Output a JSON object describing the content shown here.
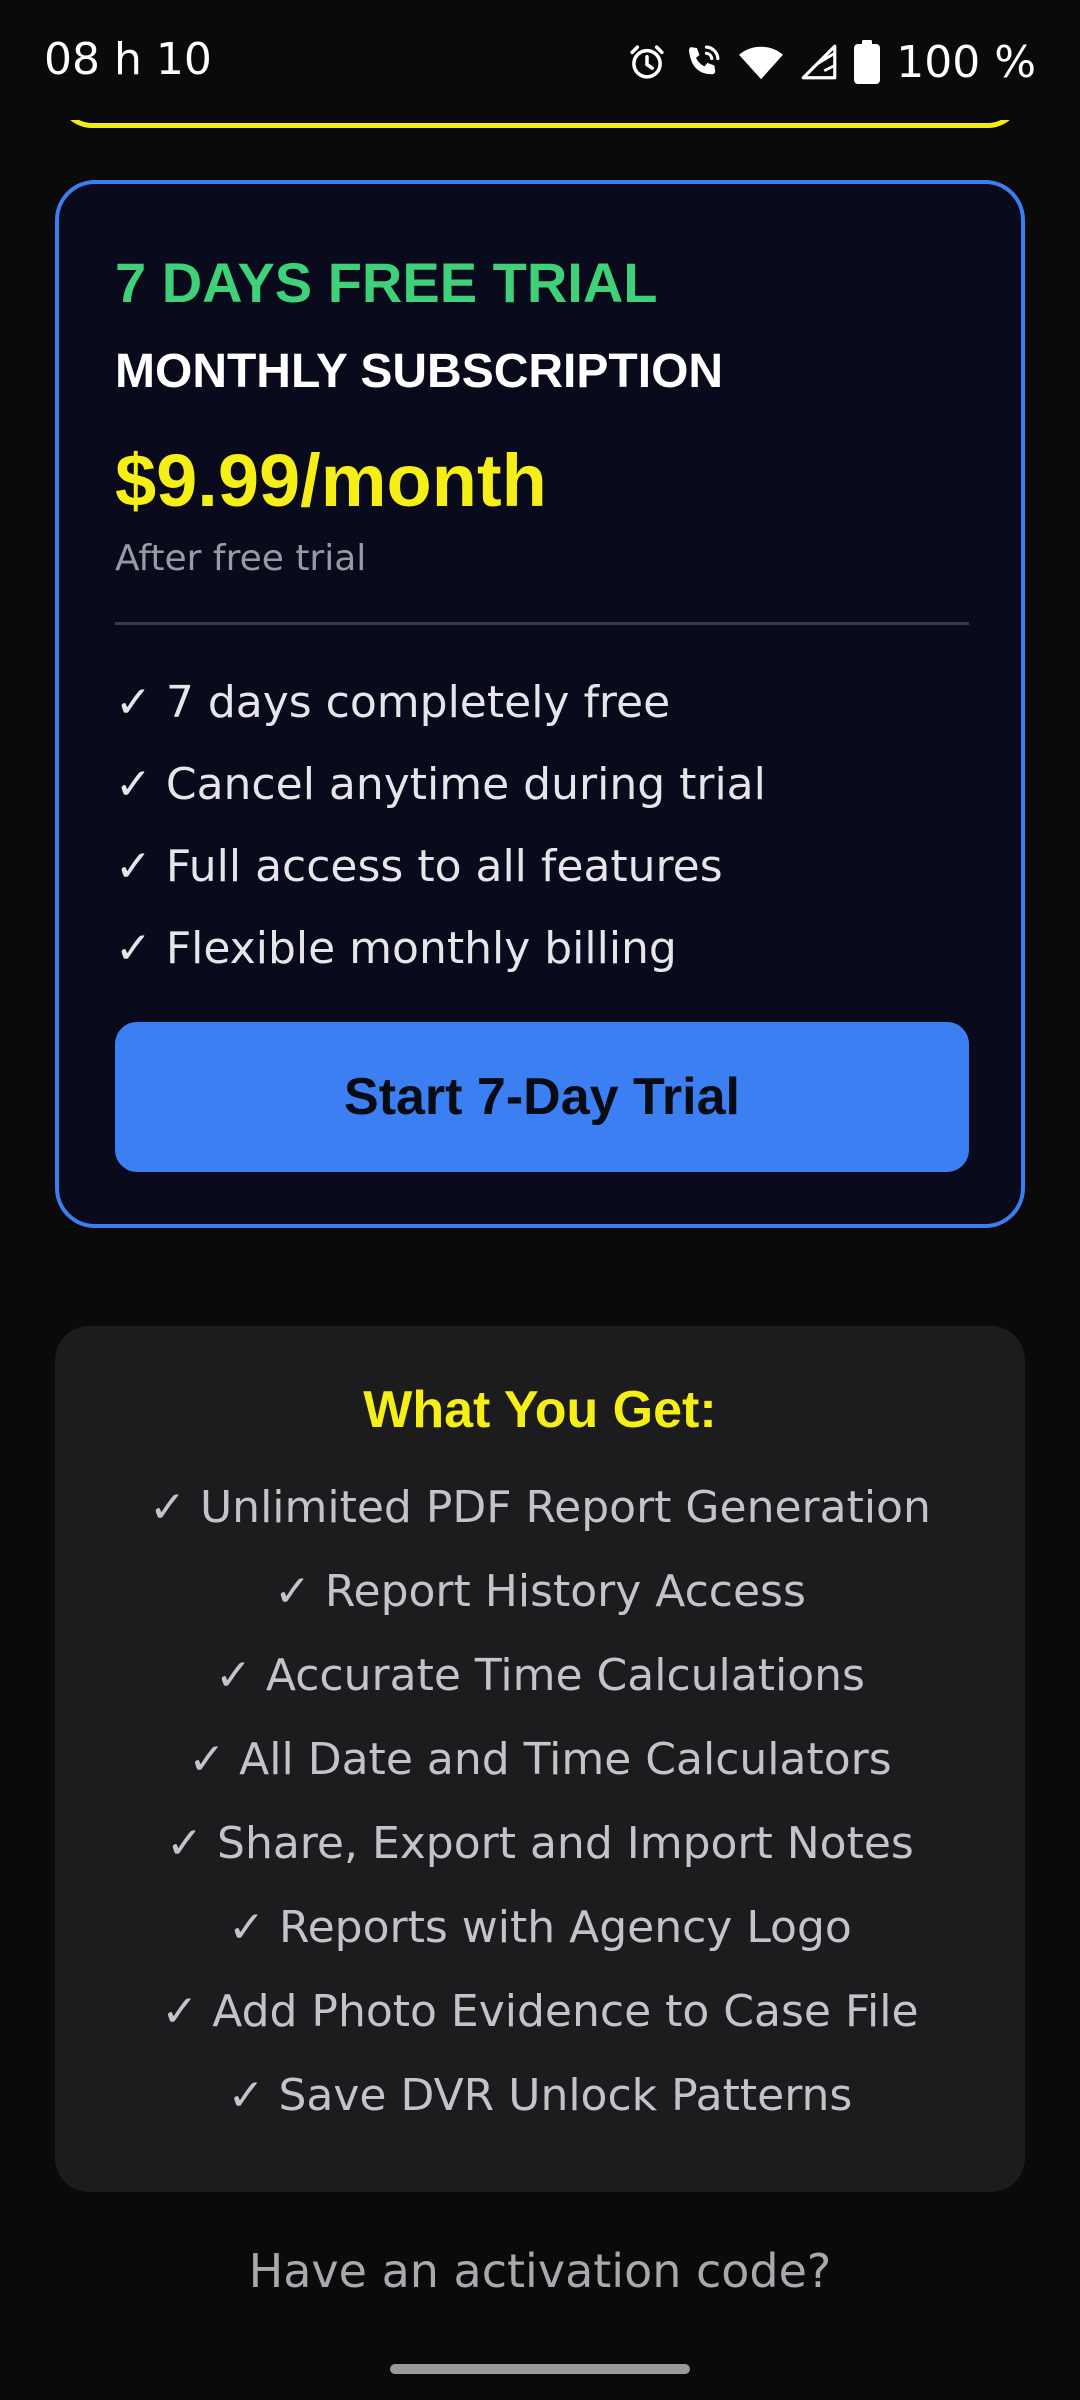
{
  "status_bar": {
    "time": "08 h 10",
    "battery_percent": "100 %",
    "icons": [
      "alarm-icon",
      "wifi-calling-icon",
      "wifi-icon",
      "signal-icon",
      "battery-icon"
    ]
  },
  "plan": {
    "trial_title": "7 DAYS FREE TRIAL",
    "name": "MONTHLY SUBSCRIPTION",
    "price": "$9.99/month",
    "price_note": "After free trial",
    "features": [
      "✓ 7 days completely free",
      "✓ Cancel anytime during trial",
      "✓ Full access to all features",
      "✓ Flexible monthly billing"
    ],
    "button_label": "Start 7-Day Trial"
  },
  "benefits": {
    "title": "What You Get:",
    "items": [
      "✓ Unlimited PDF Report Generation",
      "✓ Report History Access",
      "✓ Accurate Time Calculations",
      "✓ All Date and Time Calculators",
      "✓ Share, Export and Import Notes",
      "✓ Reports with Agency Logo",
      "✓ Add Photo Evidence to Case File",
      "✓ Save DVR Unlock Patterns"
    ]
  },
  "activation_link": "Have an activation code?",
  "colors": {
    "trial_green": "#3ed17a",
    "price_yellow": "#f5ee17",
    "accent_blue": "#3b7ff2",
    "background": "#0a0a0a"
  }
}
